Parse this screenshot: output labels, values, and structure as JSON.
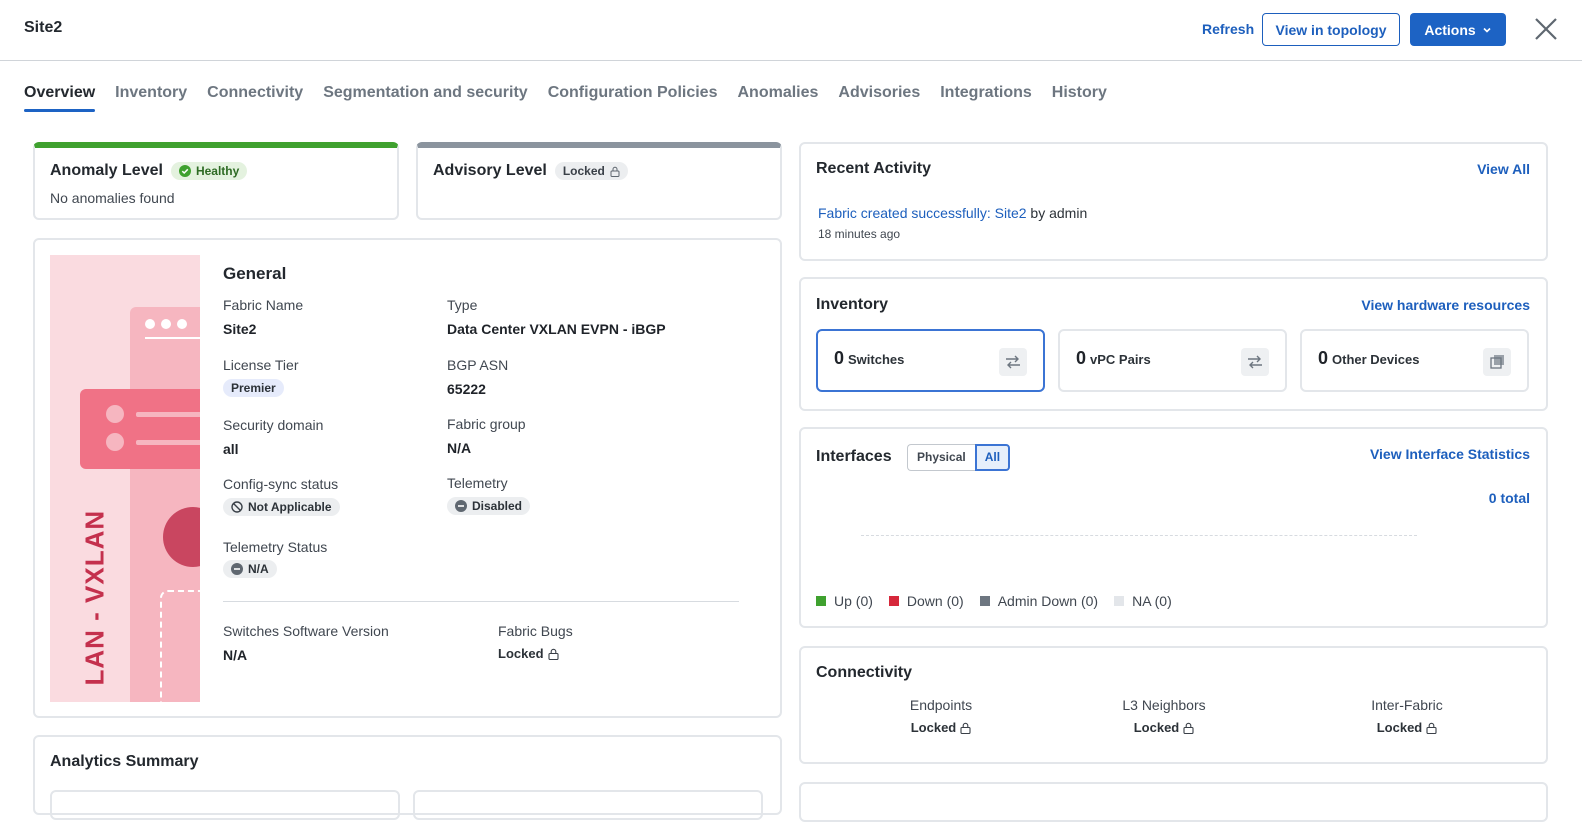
{
  "header": {
    "title": "Site2",
    "refresh_label": "Refresh",
    "view_topology_label": "View in topology",
    "actions_label": "Actions"
  },
  "tabs": [
    {
      "label": "Overview",
      "active": true
    },
    {
      "label": "Inventory"
    },
    {
      "label": "Connectivity"
    },
    {
      "label": "Segmentation and security"
    },
    {
      "label": "Configuration Policies"
    },
    {
      "label": "Anomalies"
    },
    {
      "label": "Advisories"
    },
    {
      "label": "Integrations"
    },
    {
      "label": "History"
    }
  ],
  "anomaly": {
    "title": "Anomaly Level",
    "badge": "Healthy",
    "subtitle": "No anomalies found",
    "accent_color": "#3fa12f"
  },
  "advisory": {
    "title": "Advisory Level",
    "badge": "Locked",
    "accent_color": "#8b949e"
  },
  "general": {
    "title": "General",
    "illustration_text": "LAN - VXLAN",
    "fields": {
      "fabric_name_label": "Fabric Name",
      "fabric_name_value": "Site2",
      "type_label": "Type",
      "type_value": "Data Center VXLAN EVPN - iBGP",
      "license_label": "License Tier",
      "license_value": "Premier",
      "bgp_label": "BGP ASN",
      "bgp_value": "65222",
      "security_label": "Security domain",
      "security_value": "all",
      "fabric_group_label": "Fabric group",
      "fabric_group_value": "N/A",
      "config_sync_label": "Config-sync status",
      "config_sync_value": "Not Applicable",
      "telemetry_label": "Telemetry",
      "telemetry_value": "Disabled",
      "telemetry_status_label": "Telemetry Status",
      "telemetry_status_value": "N/A",
      "sw_version_label": "Switches Software Version",
      "sw_version_value": "N/A",
      "bugs_label": "Fabric Bugs",
      "bugs_value": "Locked"
    }
  },
  "analytics": {
    "title": "Analytics Summary"
  },
  "recent_activity": {
    "title": "Recent Activity",
    "view_all": "View All",
    "item_link": "Fabric created successfully: Site2",
    "item_by": "by admin",
    "item_time": "18 minutes ago"
  },
  "inventory": {
    "title": "Inventory",
    "link": "View hardware resources",
    "boxes": [
      {
        "count": "0",
        "label": "Switches"
      },
      {
        "count": "0",
        "label": "vPC Pairs"
      },
      {
        "count": "0",
        "label": "Other Devices"
      }
    ]
  },
  "interfaces": {
    "title": "Interfaces",
    "toggle_physical": "Physical",
    "toggle_all": "All",
    "link": "View Interface Statistics",
    "total": "0 total",
    "legend": [
      {
        "label": "Up (0)",
        "color": "#3fa12f"
      },
      {
        "label": "Down (0)",
        "color": "#d6283b"
      },
      {
        "label": "Admin Down (0)",
        "color": "#6d7680"
      },
      {
        "label": "NA (0)",
        "color": "#e3e6ea"
      }
    ]
  },
  "connectivity": {
    "title": "Connectivity",
    "items": [
      {
        "label": "Endpoints",
        "value": "Locked"
      },
      {
        "label": "L3 Neighbors",
        "value": "Locked"
      },
      {
        "label": "Inter-Fabric",
        "value": "Locked"
      }
    ]
  }
}
